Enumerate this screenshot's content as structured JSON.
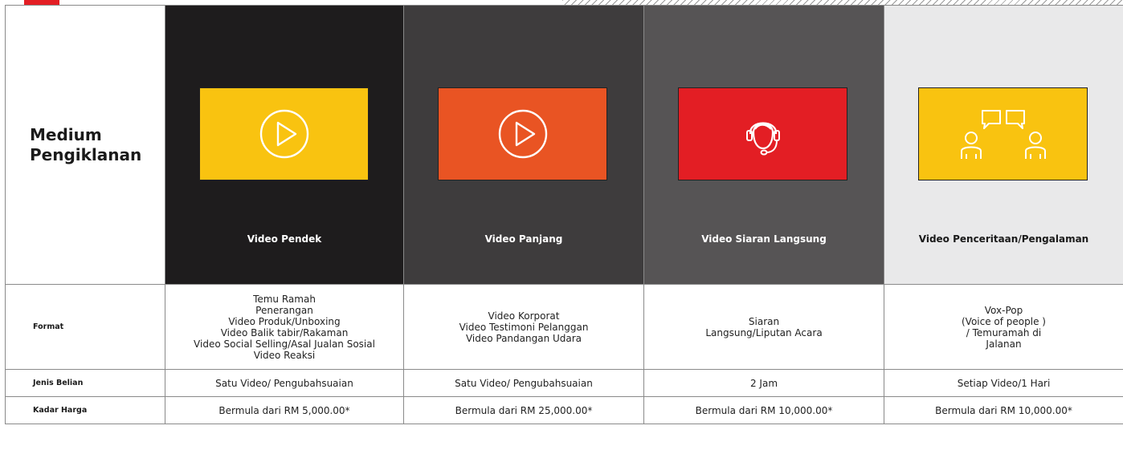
{
  "page": {
    "title": "Medium Pengiklanan",
    "accent_color": "#e31e24"
  },
  "media": [
    {
      "label": "Video Pendek",
      "bg": "#1e1c1d",
      "thumb": "#f9c310",
      "icon": "play-icon",
      "label_color": "#ffffff"
    },
    {
      "label": "Video Panjang",
      "bg": "#3e3c3d",
      "thumb": "#e95423",
      "icon": "play-icon",
      "label_color": "#ffffff"
    },
    {
      "label": "Video Siaran Langsung",
      "bg": "#565455",
      "thumb": "#e31e24",
      "icon": "headset-agent-icon",
      "label_color": "#ffffff"
    },
    {
      "label": "Video Penceritaan/Pengalaman",
      "bg": "#e9e9ea",
      "thumb": "#f9c310",
      "icon": "conversation-icon",
      "label_color": "#1a1a1a"
    }
  ],
  "rows": {
    "format": {
      "label": "Format",
      "values": [
        [
          "Temu Ramah",
          "Penerangan",
          "Video Produk/Unboxing",
          "Video Balik tabir/Rakaman",
          "Video Social Selling/Asal Jualan Sosial",
          "Video Reaksi"
        ],
        [
          "Video Korporat",
          "Video Testimoni Pelanggan",
          "Video Pandangan Udara"
        ],
        [
          "Siaran",
          "Langsung/Liputan Acara"
        ],
        [
          "Vox-Pop",
          "(Voice of people )",
          "/ Temuramah di",
          "Jalanan"
        ]
      ]
    },
    "jenis_belian": {
      "label": "Jenis Belian",
      "values": [
        "Satu Video/ Pengubahsuaian",
        "Satu Video/ Pengubahsuaian",
        "2 Jam",
        "Setiap Video/1 Hari"
      ]
    },
    "kadar_harga": {
      "label": "Kadar Harga",
      "values": [
        "Bermula dari RM 5,000.00*",
        "Bermula dari RM 25,000.00*",
        "Bermula dari RM 10,000.00*",
        "Bermula dari RM 10,000.00*"
      ]
    }
  }
}
